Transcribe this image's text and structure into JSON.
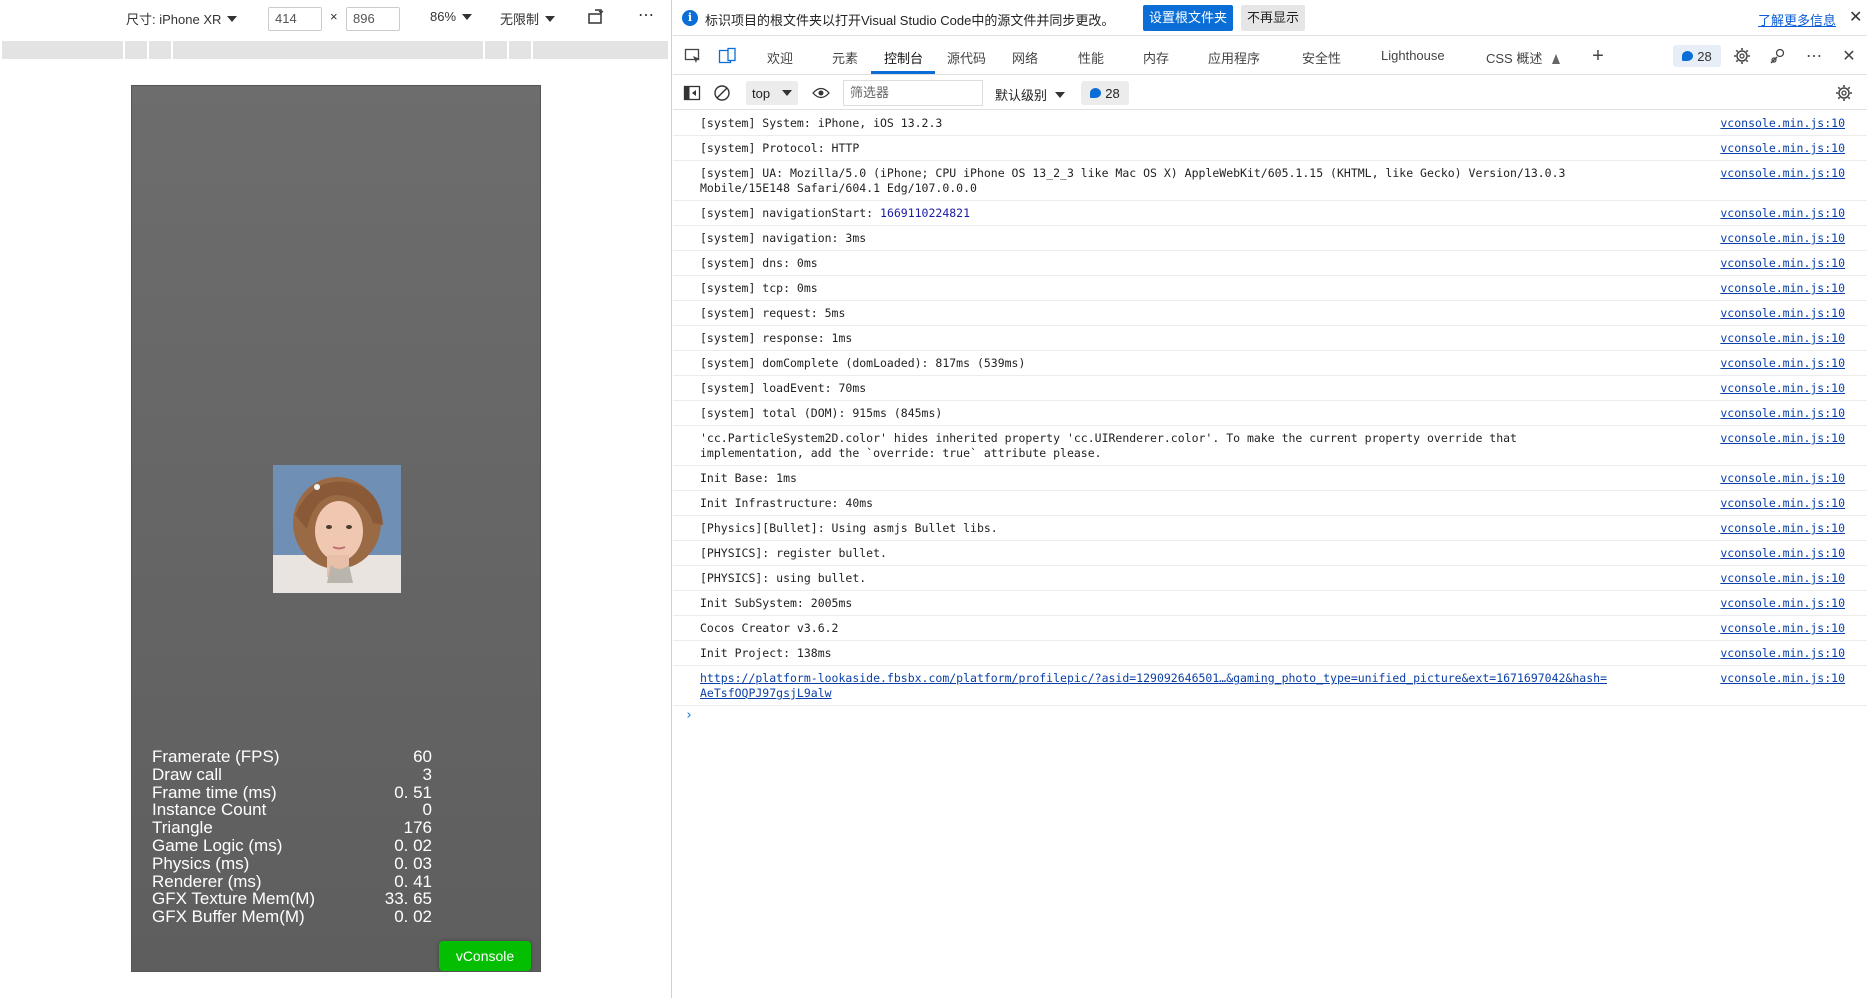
{
  "device_toolbar": {
    "size_label": "尺寸: iPhone XR",
    "width": "414",
    "times": "×",
    "height": "896",
    "zoom": "86%",
    "throttle": "无限制",
    "more": "⋯"
  },
  "stats": [
    {
      "label": "Framerate (FPS)",
      "value": "60"
    },
    {
      "label": "Draw call",
      "value": "3"
    },
    {
      "label": "Frame time (ms)",
      "value": "0. 51"
    },
    {
      "label": "Instance Count",
      "value": "0"
    },
    {
      "label": "Triangle",
      "value": "176"
    },
    {
      "label": "Game Logic (ms)",
      "value": "0. 02"
    },
    {
      "label": "Physics (ms)",
      "value": "0. 03"
    },
    {
      "label": "Renderer (ms)",
      "value": "0. 41"
    },
    {
      "label": "GFX Texture Mem(M)",
      "value": "33. 65"
    },
    {
      "label": "GFX Buffer Mem(M)",
      "value": "0. 02"
    }
  ],
  "vconsole_label": "vConsole",
  "infobar": {
    "icon": "i",
    "text": "标识项目的根文件夹以打开Visual Studio Code中的源文件并同步更改。",
    "set_root": "设置根文件夹",
    "dismiss": "不再显示",
    "learn_more": "了解更多信息",
    "close": "✕"
  },
  "tabs": {
    "welcome": "欢迎",
    "elements": "元素",
    "console": "控制台",
    "sources": "源代码",
    "network": "网络",
    "performance": "性能",
    "memory": "内存",
    "application": "应用程序",
    "security": "安全性",
    "lighthouse": "Lighthouse",
    "css_overview": "CSS 概述",
    "message_count": "28"
  },
  "console_toolbar": {
    "context": "top",
    "filter_placeholder": "筛选器",
    "levels": "默认级别",
    "issues_count": "28"
  },
  "log_rows": [
    {
      "msg": "[system] System: iPhone, iOS 13.2.3",
      "src": "vconsole.min.js:10"
    },
    {
      "msg": "[system] Protocol: HTTP",
      "src": "vconsole.min.js:10"
    },
    {
      "msg": "[system] UA: Mozilla/5.0 (iPhone; CPU iPhone OS 13_2_3 like Mac OS X) AppleWebKit/605.1.15 (KHTML, like Gecko) Version/13.0.3\nMobile/15E148 Safari/604.1 Edg/107.0.0.0",
      "src": "vconsole.min.js:10"
    },
    {
      "msg_prefix": "[system] navigationStart: ",
      "msg_num": "1669110224821",
      "src": "vconsole.min.js:10"
    },
    {
      "msg": "[system] navigation: 3ms",
      "src": "vconsole.min.js:10"
    },
    {
      "msg": "[system] dns: 0ms",
      "src": "vconsole.min.js:10"
    },
    {
      "msg": "[system] tcp: 0ms",
      "src": "vconsole.min.js:10"
    },
    {
      "msg": "[system] request: 5ms",
      "src": "vconsole.min.js:10"
    },
    {
      "msg": "[system] response: 1ms",
      "src": "vconsole.min.js:10"
    },
    {
      "msg": "[system] domComplete (domLoaded): 817ms (539ms)",
      "src": "vconsole.min.js:10"
    },
    {
      "msg": "[system] loadEvent: 70ms",
      "src": "vconsole.min.js:10"
    },
    {
      "msg": "[system] total (DOM): 915ms (845ms)",
      "src": "vconsole.min.js:10"
    },
    {
      "msg": "'cc.ParticleSystem2D.color' hides inherited property 'cc.UIRenderer.color'. To make the current property override that\nimplementation, add the `override: true` attribute please.",
      "src": "vconsole.min.js:10"
    },
    {
      "msg": "Init Base: 1ms",
      "src": "vconsole.min.js:10"
    },
    {
      "msg": "Init Infrastructure: 40ms",
      "src": "vconsole.min.js:10"
    },
    {
      "msg": "[Physics][Bullet]: Using asmjs Bullet libs.",
      "src": "vconsole.min.js:10"
    },
    {
      "msg": "[PHYSICS]: register bullet.",
      "src": "vconsole.min.js:10"
    },
    {
      "msg": "[PHYSICS]: using bullet.",
      "src": "vconsole.min.js:10"
    },
    {
      "msg": "Init SubSystem: 2005ms",
      "src": "vconsole.min.js:10"
    },
    {
      "msg": "Cocos Creator v3.6.2",
      "src": "vconsole.min.js:10"
    },
    {
      "msg": "Init Project: 138ms",
      "src": "vconsole.min.js:10"
    },
    {
      "link": "https://platform-lookaside.fbsbx.com/platform/profilepic/?asid=129092646501…&gaming_photo_type=unified_picture&ext=1671697042&hash=\nAeTsfOQPJ97gsjL9alw",
      "src": "vconsole.min.js:10"
    }
  ],
  "prompt": "›"
}
